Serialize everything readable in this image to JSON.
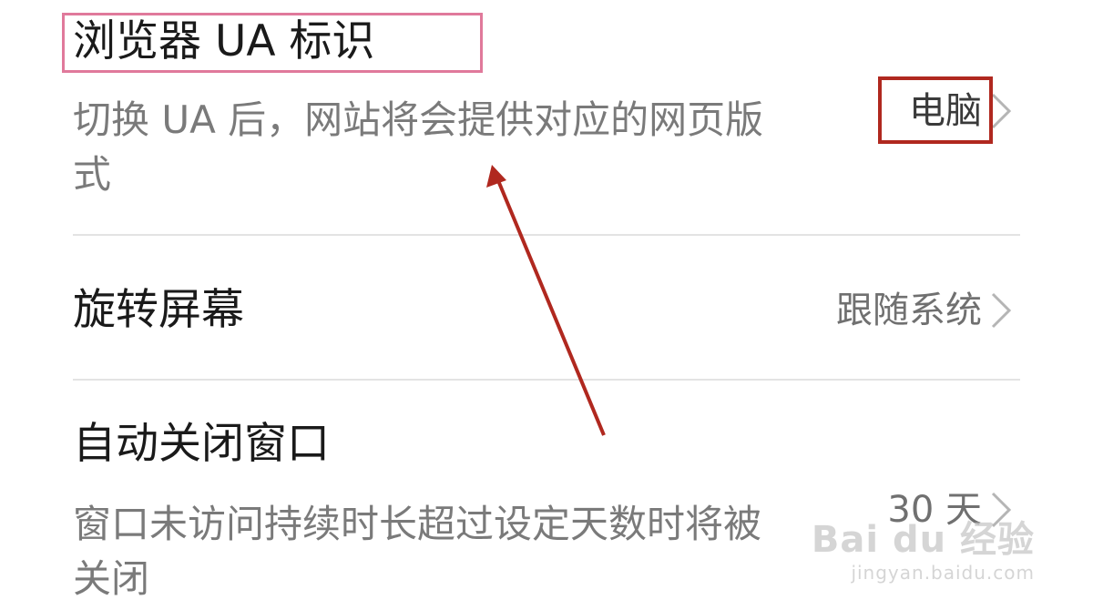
{
  "settings": {
    "items": [
      {
        "title": "浏览器 UA 标识",
        "description": "切换 UA 后，网站将会提供对应的网页版式",
        "value": "电脑",
        "icon": "chevron-right-icon"
      },
      {
        "title": "旋转屏幕",
        "description": "",
        "value": "跟随系统",
        "icon": "chevron-right-icon"
      },
      {
        "title": "自动关闭窗口",
        "description": "窗口未访问持续时长超过设定天数时将被关闭",
        "value": "30 天",
        "icon": "chevron-right-icon"
      }
    ]
  },
  "annotations": {
    "title_box_color": "#e0799b",
    "value_box_color": "#b0281f",
    "arrow_color": "#b0281f"
  },
  "watermark": {
    "brand": "Bai du 经验",
    "url": "jingyan.baidu.com"
  },
  "colors": {
    "title_text": "#1a1a1a",
    "secondary_text": "#7a7a7a",
    "divider": "#e3e3e3",
    "background": "#ffffff"
  }
}
